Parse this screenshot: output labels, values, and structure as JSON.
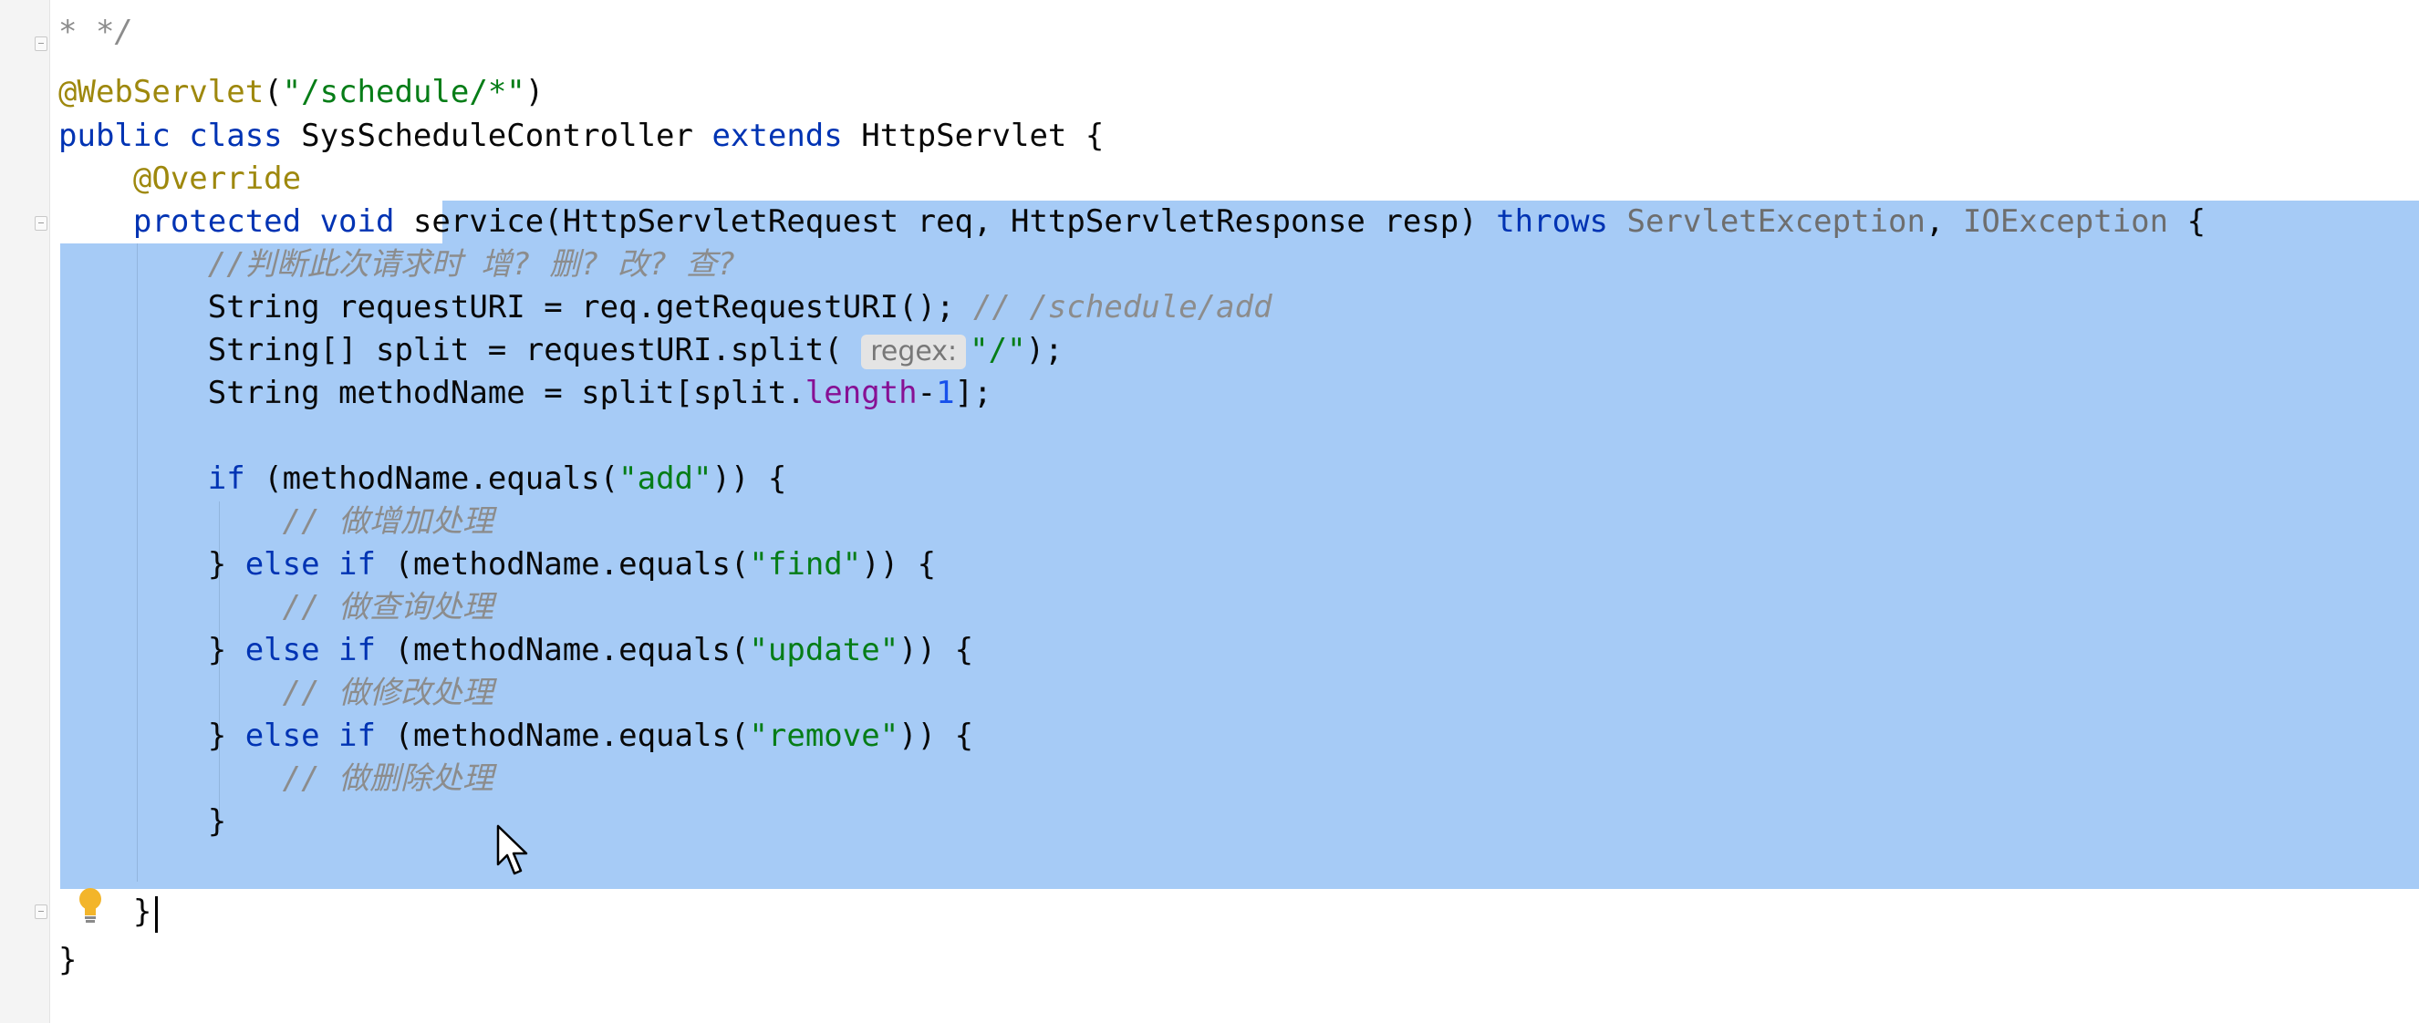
{
  "editor": {
    "lines": [
      {
        "id": "l01",
        "segments": [
          {
            "c": "cmt",
            "t": "* */"
          }
        ]
      },
      {
        "id": "l02",
        "segments": [
          {
            "c": "ann",
            "t": "@WebServlet"
          },
          {
            "c": "",
            "t": "("
          },
          {
            "c": "str",
            "t": "\"/schedule/*\""
          },
          {
            "c": "",
            "t": ")"
          }
        ]
      },
      {
        "id": "l03",
        "segments": [
          {
            "c": "kw",
            "t": "public class "
          },
          {
            "c": "",
            "t": "SysScheduleController "
          },
          {
            "c": "kw",
            "t": "extends "
          },
          {
            "c": "",
            "t": "HttpServlet {"
          }
        ]
      },
      {
        "id": "l04",
        "segments": [
          {
            "c": "",
            "t": "    "
          },
          {
            "c": "ann",
            "t": "@Override"
          }
        ]
      },
      {
        "id": "l05",
        "segments": [
          {
            "c": "",
            "t": "    "
          },
          {
            "c": "kw",
            "t": "protected void "
          },
          {
            "c": "",
            "t": "service(HttpServletRequest req, HttpServletResponse resp) "
          },
          {
            "c": "kw",
            "t": "throws "
          },
          {
            "c": "gray",
            "t": "ServletException"
          },
          {
            "c": "",
            "t": ", "
          },
          {
            "c": "gray",
            "t": "IOException"
          },
          {
            "c": "",
            "t": " {"
          }
        ]
      },
      {
        "id": "l06",
        "segments": [
          {
            "c": "",
            "t": "        "
          },
          {
            "c": "cmt",
            "t": "//判断此次请求时 增? 删? 改? 查?"
          }
        ]
      },
      {
        "id": "l07",
        "segments": [
          {
            "c": "",
            "t": "        String requestURI = req.getRequestURI(); "
          },
          {
            "c": "cmt",
            "t": "// /schedule/add"
          }
        ]
      },
      {
        "id": "l08",
        "segments": [
          {
            "c": "",
            "t": "        String[] split = requestURI.split( "
          },
          {
            "c": "hint",
            "t": "regex:"
          },
          {
            "c": "str",
            "t": "\"/\""
          },
          {
            "c": "",
            "t": ");"
          }
        ]
      },
      {
        "id": "l09",
        "segments": [
          {
            "c": "",
            "t": "        String methodName = split[split."
          },
          {
            "c": "fld",
            "t": "length"
          },
          {
            "c": "",
            "t": "-"
          },
          {
            "c": "num",
            "t": "1"
          },
          {
            "c": "",
            "t": "];"
          }
        ]
      },
      {
        "id": "l10",
        "segments": [
          {
            "c": "",
            "t": ""
          }
        ]
      },
      {
        "id": "l11",
        "segments": [
          {
            "c": "",
            "t": "        "
          },
          {
            "c": "kw",
            "t": "if "
          },
          {
            "c": "",
            "t": "(methodName.equals("
          },
          {
            "c": "str",
            "t": "\"add\""
          },
          {
            "c": "",
            "t": ")) {"
          }
        ]
      },
      {
        "id": "l12",
        "segments": [
          {
            "c": "",
            "t": "            "
          },
          {
            "c": "cmt",
            "t": "// 做增加处理"
          }
        ]
      },
      {
        "id": "l13",
        "segments": [
          {
            "c": "",
            "t": "        } "
          },
          {
            "c": "kw",
            "t": "else if "
          },
          {
            "c": "",
            "t": "(methodName.equals("
          },
          {
            "c": "str",
            "t": "\"find\""
          },
          {
            "c": "",
            "t": ")) {"
          }
        ]
      },
      {
        "id": "l14",
        "segments": [
          {
            "c": "",
            "t": "            "
          },
          {
            "c": "cmt",
            "t": "// 做查询处理"
          }
        ]
      },
      {
        "id": "l15",
        "segments": [
          {
            "c": "",
            "t": "        } "
          },
          {
            "c": "kw",
            "t": "else if "
          },
          {
            "c": "",
            "t": "(methodName.equals("
          },
          {
            "c": "str",
            "t": "\"update\""
          },
          {
            "c": "",
            "t": ")) {"
          }
        ]
      },
      {
        "id": "l16",
        "segments": [
          {
            "c": "",
            "t": "            "
          },
          {
            "c": "cmt",
            "t": "// 做修改处理"
          }
        ]
      },
      {
        "id": "l17",
        "segments": [
          {
            "c": "",
            "t": "        } "
          },
          {
            "c": "kw",
            "t": "else if "
          },
          {
            "c": "",
            "t": "(methodName.equals("
          },
          {
            "c": "str",
            "t": "\"remove\""
          },
          {
            "c": "",
            "t": ")) {"
          }
        ]
      },
      {
        "id": "l18",
        "segments": [
          {
            "c": "",
            "t": "            "
          },
          {
            "c": "cmt",
            "t": "// 做删除处理"
          }
        ]
      },
      {
        "id": "l19",
        "segments": [
          {
            "c": "",
            "t": "        }"
          }
        ]
      },
      {
        "id": "l20",
        "segments": [
          {
            "c": "",
            "t": ""
          }
        ]
      },
      {
        "id": "l21",
        "segments": [
          {
            "c": "",
            "t": "    }"
          }
        ]
      },
      {
        "id": "l22",
        "segments": [
          {
            "c": "",
            "t": "}"
          }
        ]
      }
    ]
  },
  "colors": {
    "selection": "#a6cbf6",
    "keyword": "#0033b3",
    "annotation": "#9e880d",
    "string": "#067d17",
    "comment": "#8c8c8c"
  },
  "icons": [
    "fold-marker-icon",
    "lightbulb-icon",
    "mouse-cursor-icon"
  ]
}
